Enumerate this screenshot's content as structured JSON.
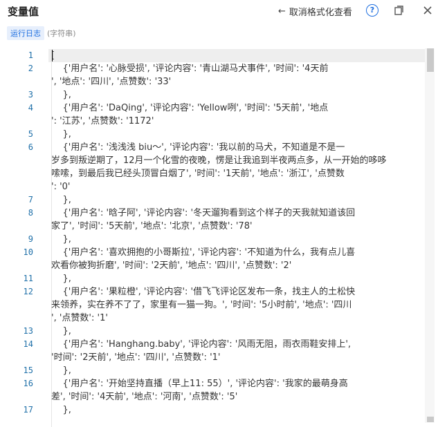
{
  "header": {
    "title": "变量值",
    "toggle_format_label": "取消格式化查看",
    "toggle_format_icon": "arrow-left-icon",
    "help_icon": "help-circle-icon",
    "popout_icon": "popout-icon",
    "close_icon": "close-icon"
  },
  "meta": {
    "tag": "运行日志",
    "type": "(字符串)"
  },
  "colors": {
    "accent": "#1e6fe0",
    "line_number": "#1e6fa8"
  },
  "lines": [
    {
      "n": "1",
      "rows": [
        "["
      ]
    },
    {
      "n": "2",
      "rows": [
        "    {'用户名': '心脉受损', '评论内容': '青山湖马犬事件', '时间': '4天前",
        "', '地点': '四川', '点赞数': '33'"
      ]
    },
    {
      "n": "3",
      "rows": [
        "    },"
      ]
    },
    {
      "n": "4",
      "rows": [
        "    {'用户名': 'DaQing', '评论内容': 'Yellow咧', '时间': '5天前', '地点",
        "': '江苏', '点赞数': '1172'"
      ]
    },
    {
      "n": "5",
      "rows": [
        "    },"
      ]
    },
    {
      "n": "6",
      "rows": [
        "    {'用户名': '浅浅浅 biu～', '评论内容': '我以前的马犬，不知道是不是一",
        "岁多到叛逆期了，12月一个化雪的夜晚，愣是让我追到半夜两点多，从一开始的哆哆",
        "嗦嗦，到最后我已经头顶冒白烟了', '时间': '1天前', '地点': '浙江', '点赞数",
        "': '0'"
      ]
    },
    {
      "n": "7",
      "rows": [
        "    },"
      ]
    },
    {
      "n": "8",
      "rows": [
        "    {'用户名': '晗子阿', '评论内容': '冬天遛狗看到这个样子的天我就知道该回",
        "家了', '时间': '5天前', '地点': '北京', '点赞数': '78'"
      ]
    },
    {
      "n": "9",
      "rows": [
        "    },"
      ]
    },
    {
      "n": "10",
      "rows": [
        "    {'用户名': '喜欢拥抱的小哥斯拉', '评论内容': '不知道为什么，我有点儿喜",
        "欢看你被狗折磨', '时间': '2天前', '地点': '四川', '点赞数': '2'"
      ]
    },
    {
      "n": "11",
      "rows": [
        "    },"
      ]
    },
    {
      "n": "12",
      "rows": [
        "    {'用户名': '果粒橙', '评论内容': '借飞飞评论区发布一条，找主人的土松快",
        "来领养，实在养不了了，家里有一猫一狗。', '时间': '5小时前', '地点': '四川",
        "', '点赞数': '1'"
      ]
    },
    {
      "n": "13",
      "rows": [
        "    },"
      ]
    },
    {
      "n": "14",
      "rows": [
        "    {'用户名': 'Hanghang.baby', '评论内容': '风雨无阻，雨衣雨鞋安排上',",
        "'时间': '2天前', '地点': '四川', '点赞数': '1'"
      ]
    },
    {
      "n": "15",
      "rows": [
        "    },"
      ]
    },
    {
      "n": "16",
      "rows": [
        "    {'用户名': '开始坚持直播（早上11: 55）', '评论内容': '我家的最萌身高",
        "差', '时间': '4天前', '地点': '河南', '点赞数': '5'"
      ]
    },
    {
      "n": "17",
      "rows": [
        "    },"
      ]
    }
  ]
}
